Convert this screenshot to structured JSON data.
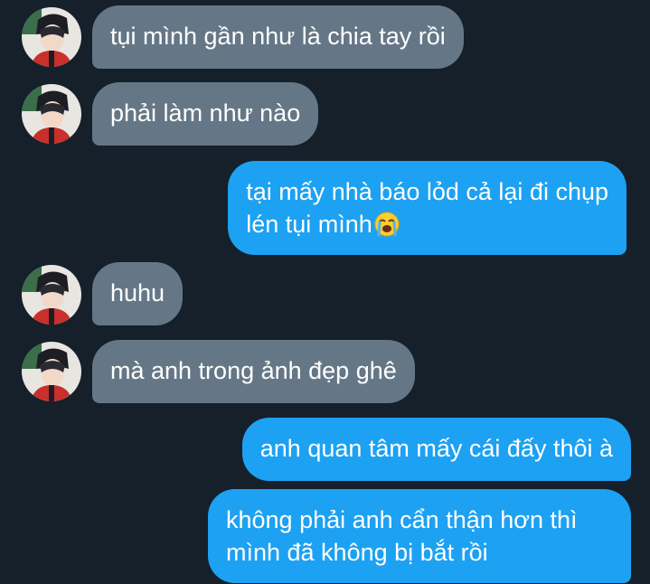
{
  "messages": [
    {
      "direction": "incoming",
      "text": "tụi mình gần như là chia tay rồi",
      "avatar_icon": "profile-avatar-icon"
    },
    {
      "direction": "incoming",
      "text": "phải làm như nào",
      "avatar_icon": "profile-avatar-icon"
    },
    {
      "direction": "outgoing",
      "line1": "tại mấy nhà báo lỏd cả lại đi chụp",
      "line2": "lén tụi mình",
      "emoji": "loudly-crying-face-icon"
    },
    {
      "direction": "incoming",
      "text": "huhu",
      "avatar_icon": "profile-avatar-icon"
    },
    {
      "direction": "incoming",
      "text": "mà anh trong ảnh đẹp ghê",
      "avatar_icon": "profile-avatar-icon"
    },
    {
      "direction": "outgoing",
      "text": "anh quan tâm mấy cái đấy thôi à"
    },
    {
      "direction": "outgoing",
      "line1": "không phải anh cẩn thận hơn thì",
      "line2": "mình đã không bị bắt rồi"
    }
  ],
  "colors": {
    "background": "#15202b",
    "incoming_bubble": "#657786",
    "outgoing_bubble": "#1da1f2",
    "text": "#ffffff"
  }
}
